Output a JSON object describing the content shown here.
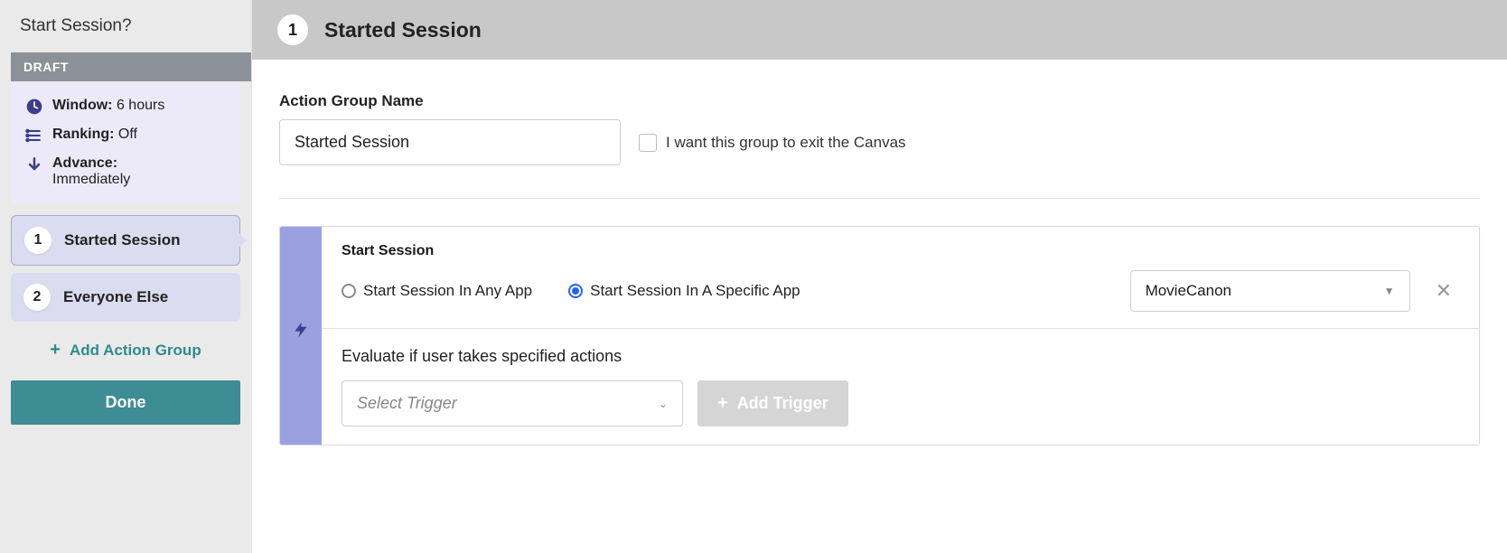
{
  "sidebar": {
    "title": "Start Session?",
    "draft_label": "DRAFT",
    "summary": {
      "window_label": "Window:",
      "window_value": "6 hours",
      "ranking_label": "Ranking:",
      "ranking_value": "Off",
      "advance_label": "Advance:",
      "advance_value": "Immediately"
    },
    "items": [
      {
        "num": "1",
        "label": "Started Session"
      },
      {
        "num": "2",
        "label": "Everyone Else"
      }
    ],
    "add_action_label": "Add Action Group",
    "done_label": "Done"
  },
  "main": {
    "header_num": "1",
    "header_title": "Started Session",
    "form": {
      "name_label": "Action Group Name",
      "name_value": "Started Session",
      "exit_canvas_label": "I want this group to exit the Canvas"
    },
    "config": {
      "section_title": "Start Session",
      "radio_any": "Start Session In Any App",
      "radio_specific": "Start Session In A Specific App",
      "app_selected": "MovieCanon",
      "eval_text": "Evaluate if user takes specified actions",
      "trigger_placeholder": "Select Trigger",
      "add_trigger_label": "Add Trigger"
    }
  }
}
